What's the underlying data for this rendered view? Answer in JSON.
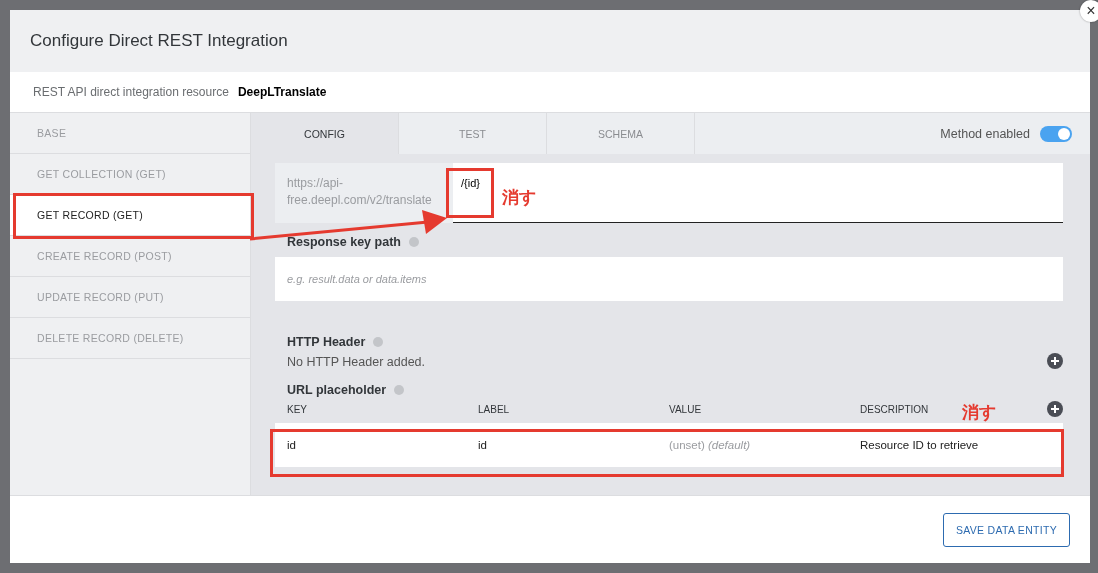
{
  "dialog": {
    "title": "Configure Direct REST Integration",
    "close_icon": "×"
  },
  "resource": {
    "label": "REST API direct integration resource",
    "value": "DeepLTranslate"
  },
  "methods": [
    {
      "label": "BASE",
      "selected": false
    },
    {
      "label": "GET COLLECTION (GET)",
      "selected": false
    },
    {
      "label": "GET RECORD (GET)",
      "selected": true
    },
    {
      "label": "CREATE RECORD (POST)",
      "selected": false
    },
    {
      "label": "UPDATE RECORD (PUT)",
      "selected": false
    },
    {
      "label": "DELETE RECORD (DELETE)",
      "selected": false
    }
  ],
  "tabs": [
    {
      "label": "CONFIG",
      "selected": true
    },
    {
      "label": "TEST",
      "selected": false
    },
    {
      "label": "SCHEMA",
      "selected": false
    }
  ],
  "method_enabled": {
    "label": "Method enabled",
    "on": true
  },
  "url": {
    "prefix": "https://api-free.deepl.com/v2/translate",
    "value": "/{id}"
  },
  "response_key_path": {
    "label": "Response key path",
    "placeholder": "e.g. result.data or data.items"
  },
  "http_header": {
    "label": "HTTP Header",
    "empty_text": "No HTTP Header added."
  },
  "url_placeholder": {
    "label": "URL placeholder",
    "columns": [
      "KEY",
      "LABEL",
      "VALUE",
      "DESCRIPTION"
    ],
    "rows": [
      [
        "id",
        "id",
        "(unset) *(default)*",
        "Resource ID to retrieve"
      ]
    ]
  },
  "annotations": [
    {
      "text": "消す"
    },
    {
      "text": "消す"
    }
  ],
  "save_button": "SAVE DATA ENTITY"
}
